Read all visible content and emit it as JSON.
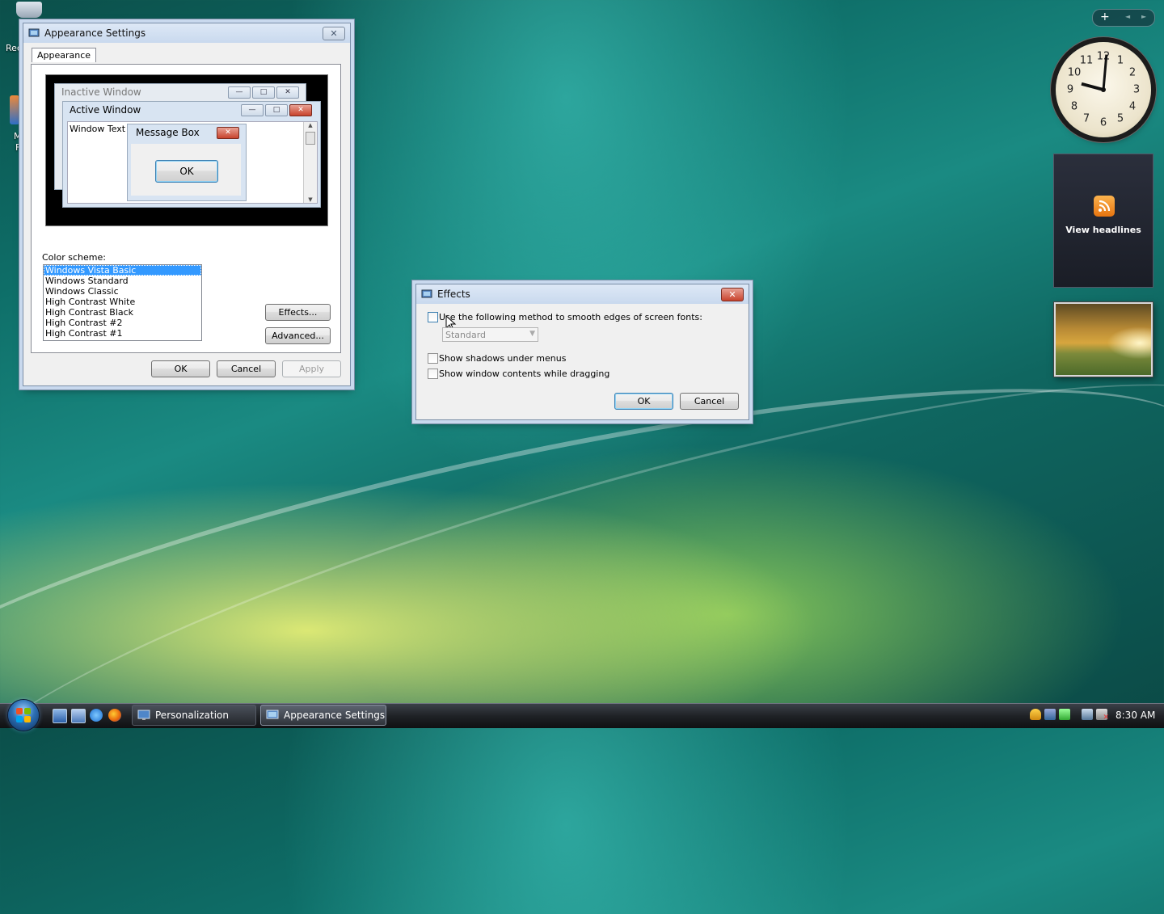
{
  "desktop": {
    "recycle_label": "Rec",
    "icon2_label_a": "M",
    "icon2_label_b": "F"
  },
  "appearance_dialog": {
    "title": "Appearance Settings",
    "tab_label": "Appearance",
    "preview": {
      "inactive_title": "Inactive Window",
      "active_title": "Active Window",
      "window_text": "Window Text",
      "message_box_title": "Message Box",
      "message_box_ok": "OK"
    },
    "color_scheme_label": "Color scheme:",
    "color_schemes": [
      "Windows Vista Basic",
      "Windows Standard",
      "Windows Classic",
      "High Contrast White",
      "High Contrast Black",
      "High Contrast #2",
      "High Contrast #1"
    ],
    "selected_scheme": "Windows Vista Basic",
    "effects_button": "Effects...",
    "advanced_button": "Advanced...",
    "ok_button": "OK",
    "cancel_button": "Cancel",
    "apply_button": "Apply"
  },
  "effects_dialog": {
    "title": "Effects",
    "smooth_fonts_label": "Use the following method to smooth edges of screen fonts:",
    "smooth_fonts_checked": false,
    "smoothing_method": "Standard",
    "shadows_label": "Show shadows under menus",
    "shadows_checked": false,
    "drag_contents_label": "Show window contents while dragging",
    "drag_contents_checked": false,
    "ok_button": "OK",
    "cancel_button": "Cancel"
  },
  "sidebar": {
    "add_button": "+",
    "prev_arrow": "◄",
    "next_arrow": "►",
    "clock_numbers": [
      "12",
      "1",
      "2",
      "3",
      "4",
      "5",
      "6",
      "7",
      "8",
      "9",
      "10",
      "11"
    ],
    "feed_label": "View headlines"
  },
  "taskbar": {
    "tasks": [
      {
        "label": "Personalization",
        "active": false
      },
      {
        "label": "Appearance Settings",
        "active": true
      }
    ],
    "time": "8:30 AM"
  },
  "colors": {
    "selection": "#3399ff",
    "rss_orange": "#f39a2a",
    "close_red": "#c8432d"
  }
}
